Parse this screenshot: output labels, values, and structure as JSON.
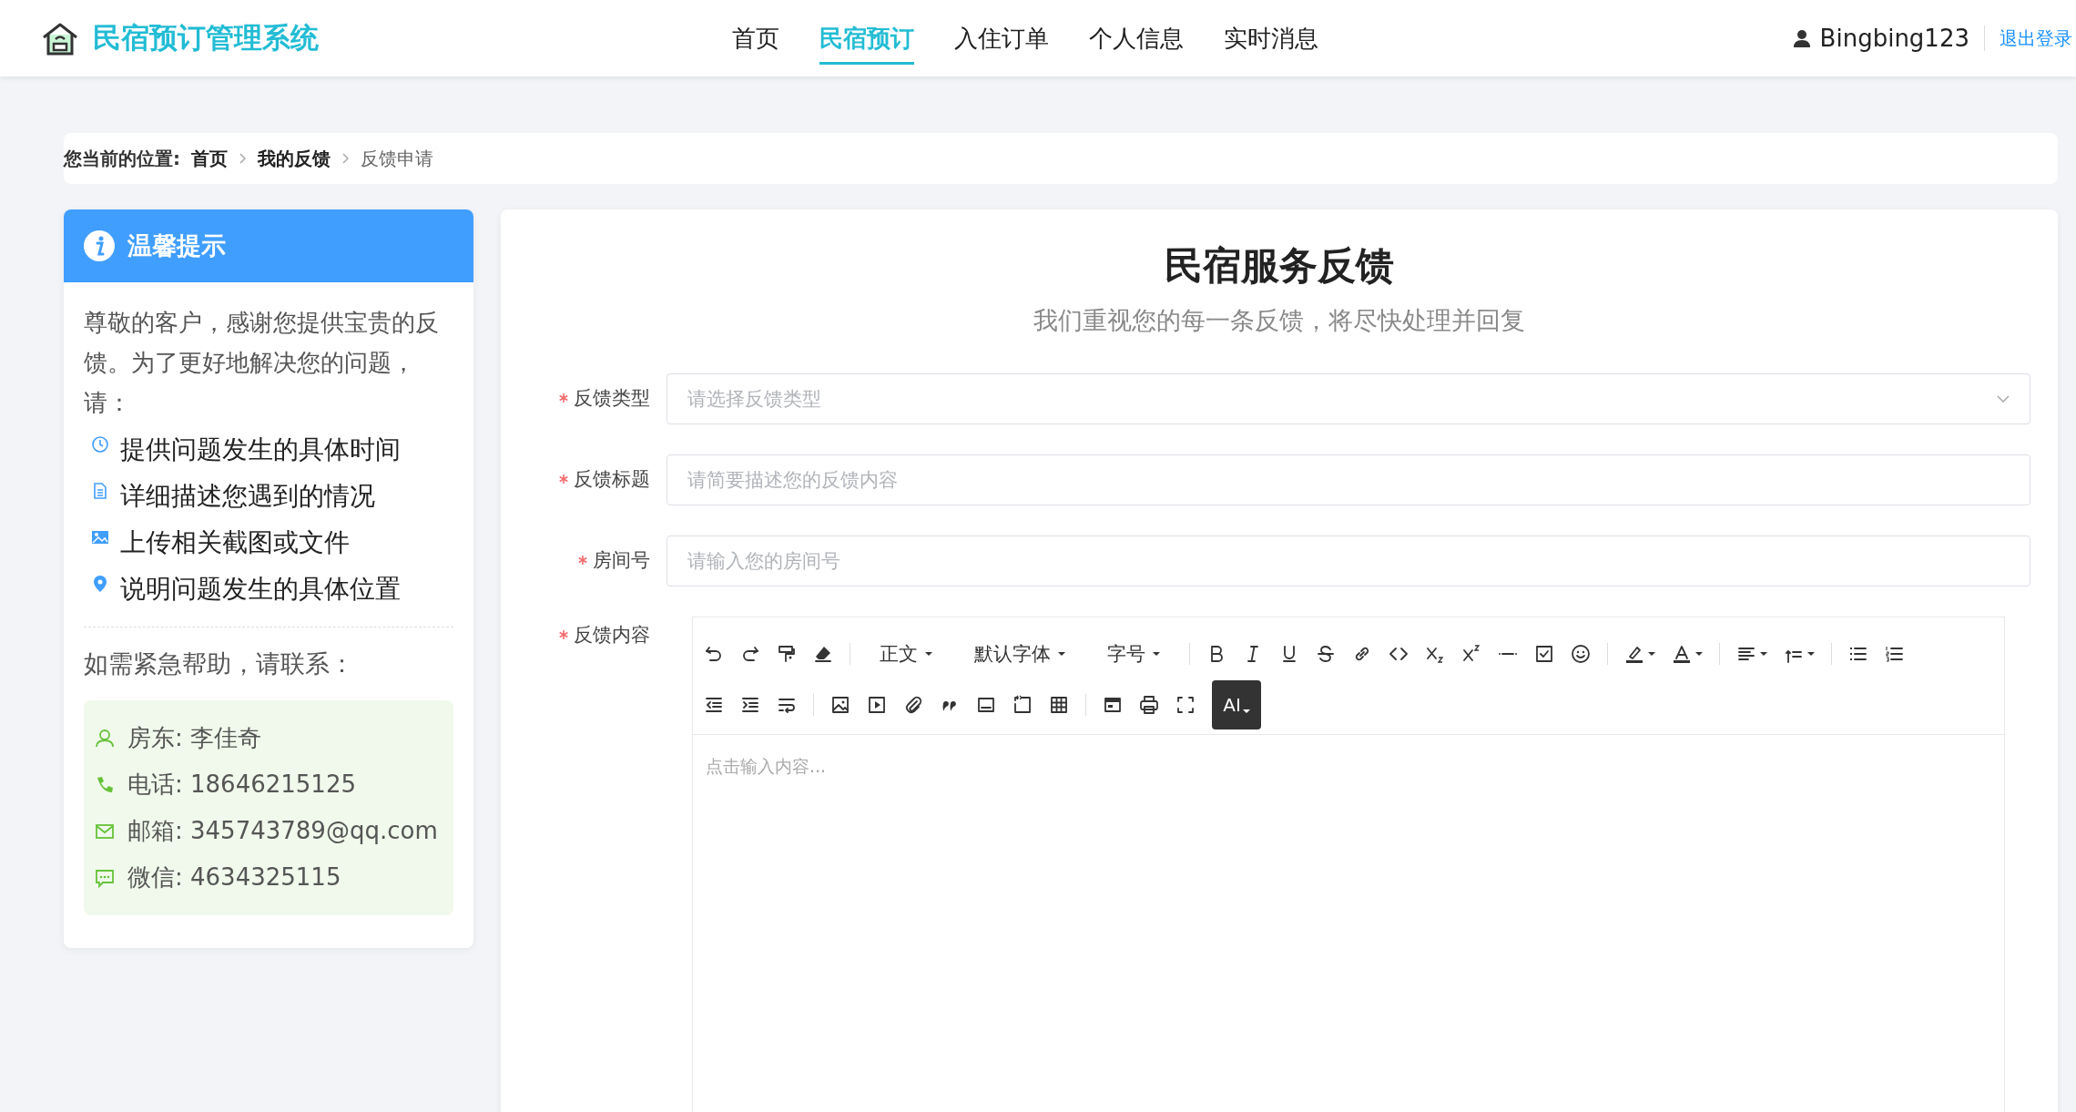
{
  "header": {
    "brand": "民宿预订管理系统",
    "nav": [
      {
        "label": "首页",
        "selected": false
      },
      {
        "label": "民宿预订",
        "selected": true
      },
      {
        "label": "入住订单",
        "selected": false
      },
      {
        "label": "个人信息",
        "selected": false
      },
      {
        "label": "实时消息",
        "selected": false
      }
    ],
    "user": "Bingbing123",
    "logout": "退出登录"
  },
  "breadcrumb": {
    "prefix": "您当前的位置:",
    "items": [
      {
        "label": "首页",
        "current": false
      },
      {
        "label": "我的反馈",
        "current": false
      },
      {
        "label": "反馈申请",
        "current": true
      }
    ]
  },
  "tips": {
    "title": "温馨提示",
    "intro": "尊敬的客户，感谢您提供宝贵的反馈。为了更好地解决您的问题，请：",
    "items": [
      "提供问题发生的具体时间",
      "详细描述您遇到的情况",
      "上传相关截图或文件",
      "说明问题发生的具体位置"
    ],
    "help": "如需紧急帮助，请联系：",
    "contacts": [
      "房东: 李佳奇",
      "电话: 18646215125",
      "邮箱: 345743789@qq.com",
      "微信: 4634325115"
    ]
  },
  "form": {
    "title": "民宿服务反馈",
    "subtitle": "我们重视您的每一条反馈，将尽快处理并回复",
    "fields": [
      {
        "label": "反馈类型",
        "required": true,
        "kind": "select",
        "placeholder": "请选择反馈类型"
      },
      {
        "label": "反馈标题",
        "required": true,
        "kind": "input",
        "placeholder": "请简要描述您的反馈内容"
      },
      {
        "label": "房间号",
        "required": true,
        "kind": "input",
        "placeholder": "请输入您的房间号"
      },
      {
        "label": "反馈内容",
        "required": true,
        "kind": "editor",
        "placeholder": "点击输入内容..."
      }
    ],
    "toolbar": {
      "dropdowns": [
        "正文",
        "默认字体",
        "字号"
      ],
      "ai": "AI"
    }
  }
}
